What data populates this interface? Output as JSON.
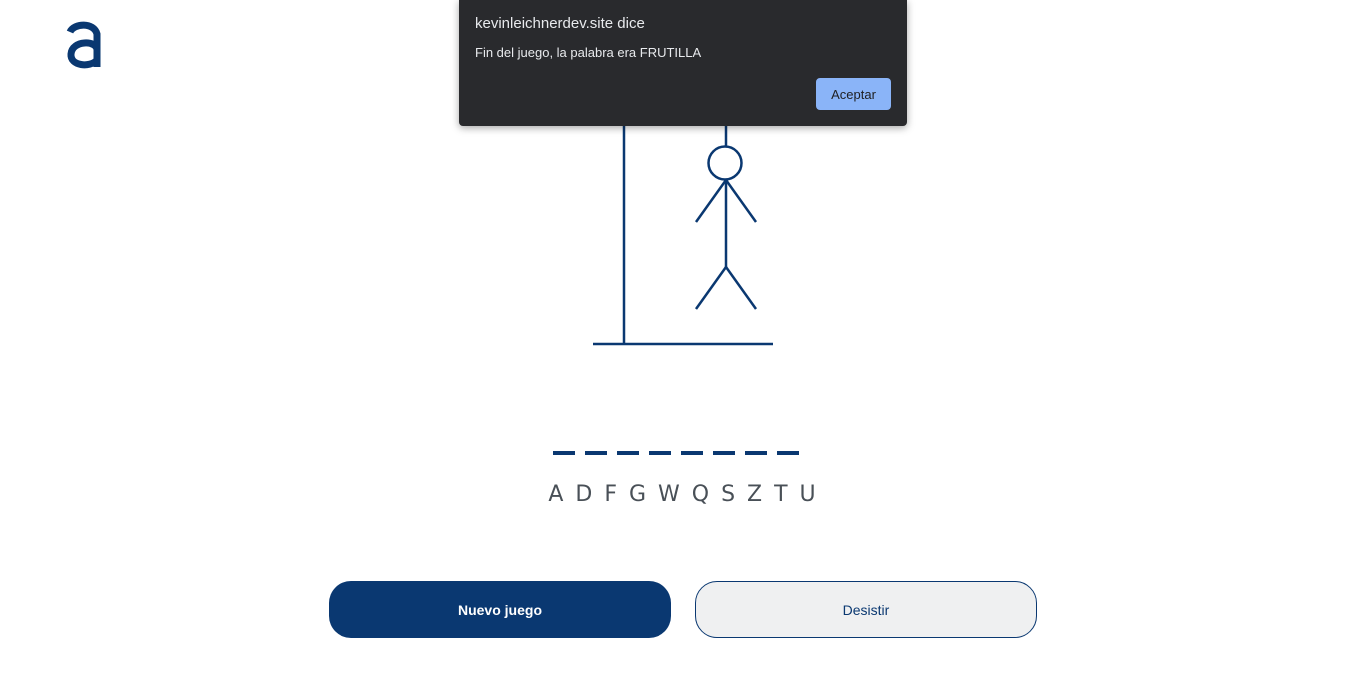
{
  "logo": {
    "icon": "alura-logo-icon",
    "color": "#0a3871"
  },
  "game": {
    "word_length": 8,
    "wrong_letters": "A D F G W Q S Z T U",
    "stroke_color": "#0a3871"
  },
  "buttons": {
    "new_game_label": "Nuevo juego",
    "quit_label": "Desistir"
  },
  "dialog": {
    "title": "kevinleichnerdev.site dice",
    "message": "Fin del juego, la palabra era FRUTILLA",
    "ok_label": "Aceptar"
  }
}
